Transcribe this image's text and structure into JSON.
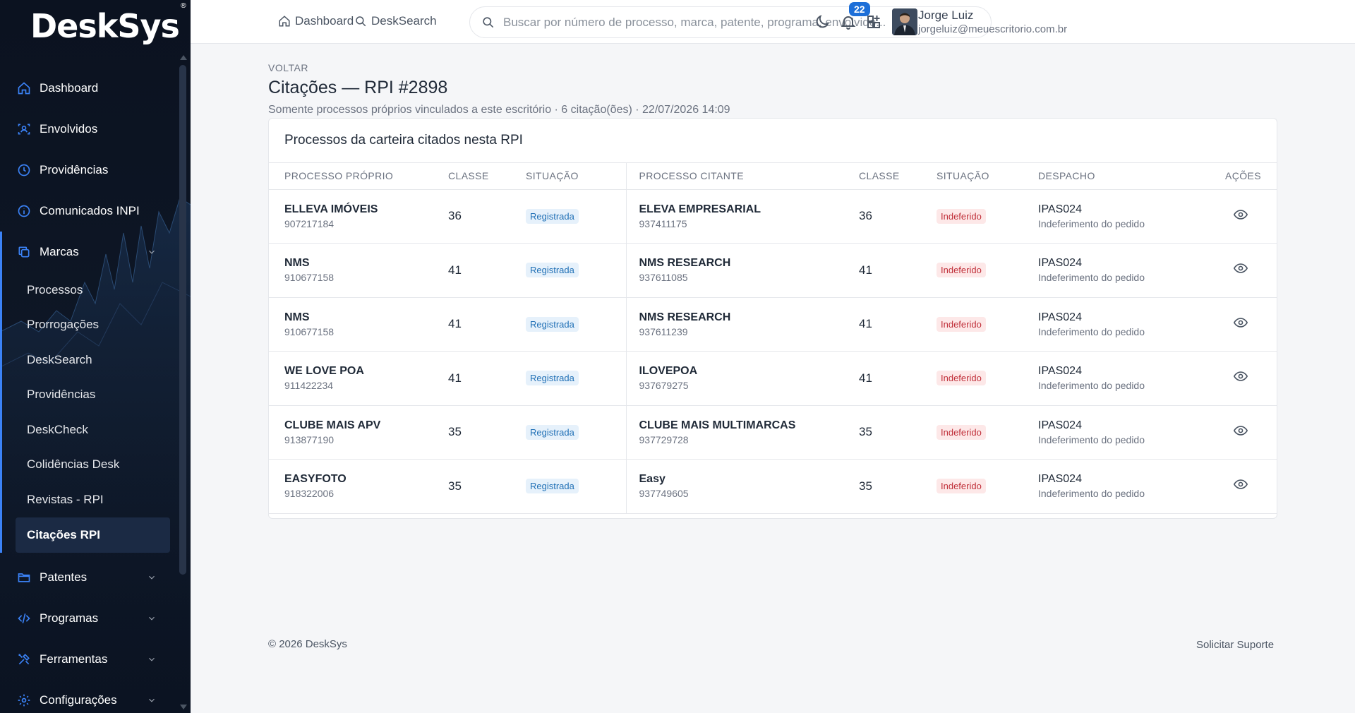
{
  "brand": {
    "name": "DeskSys",
    "mark": "®"
  },
  "sidebar": {
    "items": [
      {
        "label": "Dashboard",
        "icon": "home-icon"
      },
      {
        "label": "Envolvidos",
        "icon": "users-scan-icon"
      },
      {
        "label": "Providências",
        "icon": "clock-icon"
      },
      {
        "label": "Comunicados INPI",
        "icon": "info-icon"
      },
      {
        "label": "Marcas",
        "icon": "copy-icon",
        "expanded": true
      },
      {
        "label": "Patentes",
        "icon": "folder-icon"
      },
      {
        "label": "Programas",
        "icon": "code-icon"
      },
      {
        "label": "Ferramentas",
        "icon": "tools-icon"
      },
      {
        "label": "Configurações",
        "icon": "gear-icon"
      }
    ],
    "marcas_sub": [
      "Processos",
      "Prorrogações",
      "DeskSearch",
      "Providências",
      "DeskCheck",
      "Colidências Desk",
      "Revistas - RPI",
      "Citações RPI"
    ],
    "selected": "Citações RPI"
  },
  "topbar": {
    "dashboard": "Dashboard",
    "desksearch": "DeskSearch",
    "search_placeholder": "Buscar por número de processo, marca, patente, programa, envolvido...",
    "notifications": "22",
    "user_name": "Jorge Luiz",
    "user_email": "jorgeluiz@meuescritorio.com.br"
  },
  "page": {
    "back": "VOLTAR",
    "title": "Citações — RPI #2898",
    "subtitle": "Somente processos próprios vinculados a este escritório · 6 citação(ões) · 22/07/2026 14:09",
    "card_title": "Processos da carteira citados nesta RPI"
  },
  "table": {
    "headers": [
      "PROCESSO PRÓPRIO",
      "CLASSE",
      "SITUAÇÃO",
      "PROCESSO CITANTE",
      "CLASSE",
      "SITUAÇÃO",
      "DESPACHO",
      "AÇÕES"
    ],
    "rows": [
      {
        "own_mark": "ELLEVA IMÓVEIS",
        "own_num": "907217184",
        "own_class": "36",
        "own_status": "Registrada",
        "cit_mark": "ELEVA EMPRESARIAL",
        "cit_num": "937411175",
        "cit_class": "36",
        "cit_status": "Indeferido",
        "desp_code": "IPAS024",
        "desp_desc": "Indeferimento do pedido"
      },
      {
        "own_mark": "NMS",
        "own_num": "910677158",
        "own_class": "41",
        "own_status": "Registrada",
        "cit_mark": "NMS RESEARCH",
        "cit_num": "937611085",
        "cit_class": "41",
        "cit_status": "Indeferido",
        "desp_code": "IPAS024",
        "desp_desc": "Indeferimento do pedido"
      },
      {
        "own_mark": "NMS",
        "own_num": "910677158",
        "own_class": "41",
        "own_status": "Registrada",
        "cit_mark": "NMS RESEARCH",
        "cit_num": "937611239",
        "cit_class": "41",
        "cit_status": "Indeferido",
        "desp_code": "IPAS024",
        "desp_desc": "Indeferimento do pedido"
      },
      {
        "own_mark": "WE LOVE POA",
        "own_num": "911422234",
        "own_class": "41",
        "own_status": "Registrada",
        "cit_mark": "ILOVEPOA",
        "cit_num": "937679275",
        "cit_class": "41",
        "cit_status": "Indeferido",
        "desp_code": "IPAS024",
        "desp_desc": "Indeferimento do pedido"
      },
      {
        "own_mark": "CLUBE MAIS APV",
        "own_num": "913877190",
        "own_class": "35",
        "own_status": "Registrada",
        "cit_mark": "CLUBE MAIS MULTIMARCAS",
        "cit_num": "937729728",
        "cit_class": "35",
        "cit_status": "Indeferido",
        "desp_code": "IPAS024",
        "desp_desc": "Indeferimento do pedido"
      },
      {
        "own_mark": "EASYFOTO",
        "own_num": "918322006",
        "own_class": "35",
        "own_status": "Registrada",
        "cit_mark": "Easy",
        "cit_num": "937749605",
        "cit_class": "35",
        "cit_status": "Indeferido",
        "desp_code": "IPAS024",
        "desp_desc": "Indeferimento do pedido"
      }
    ]
  },
  "footer": {
    "copyright": "© 2026 DeskSys",
    "support": "Solicitar Suporte"
  },
  "colors": {
    "accent": "#3b82f6",
    "sidebar_bg": "#0e1726",
    "ok": "#1f6fb5",
    "bad": "#c0303a"
  }
}
